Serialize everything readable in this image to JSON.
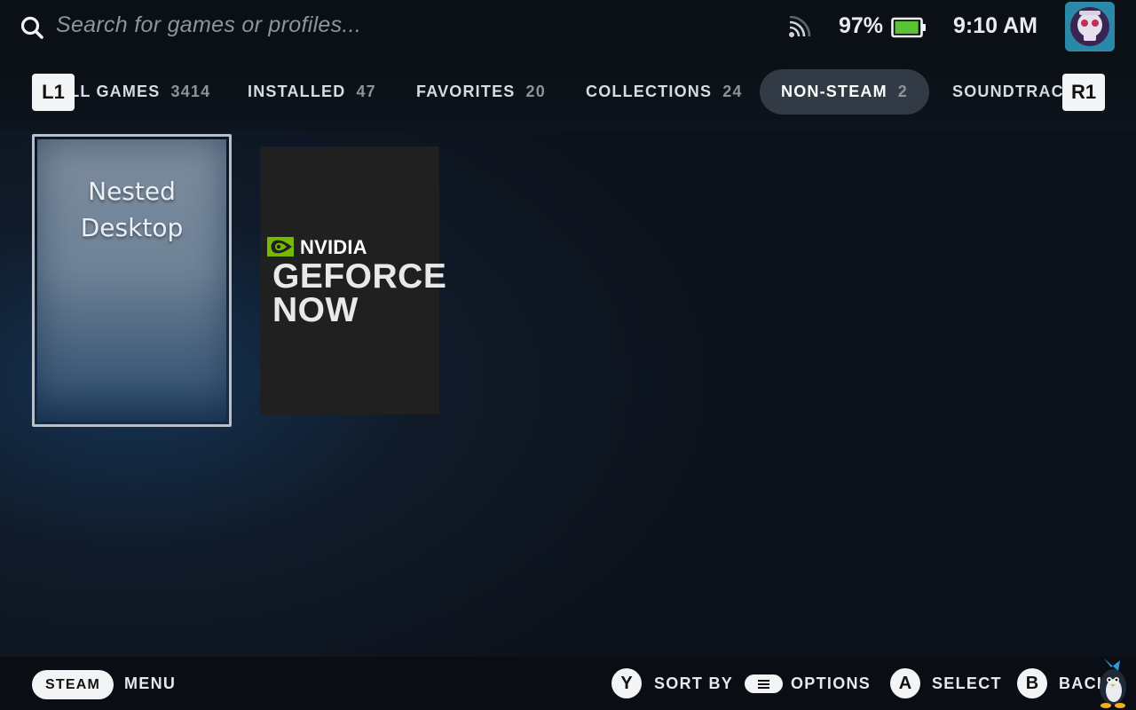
{
  "search": {
    "placeholder": "Search for games or profiles..."
  },
  "status": {
    "battery_percent": "97%",
    "battery_level": 0.97,
    "time": "9:10 AM"
  },
  "tabs": [
    {
      "label": "ALL GAMES",
      "count": "3414",
      "active": false
    },
    {
      "label": "INSTALLED",
      "count": "47",
      "active": false
    },
    {
      "label": "FAVORITES",
      "count": "20",
      "active": false
    },
    {
      "label": "COLLECTIONS",
      "count": "24",
      "active": false
    },
    {
      "label": "NON-STEAM",
      "count": "2",
      "active": true
    },
    {
      "label": "SOUNDTRACKS",
      "count": "",
      "active": false
    }
  ],
  "shoulder": {
    "left": "L1",
    "right": "R1"
  },
  "games": [
    {
      "title_line1": "Nested",
      "title_line2": "Desktop"
    },
    {
      "brand": "NVIDIA",
      "line1": "GEFORCE",
      "line2": "NOW"
    }
  ],
  "footer": {
    "steam_button": "STEAM",
    "menu_label": "MENU",
    "y_button": "Y",
    "sort_label": "SORT BY",
    "options_label": "OPTIONS",
    "a_button": "A",
    "select_label": "SELECT",
    "b_button": "B",
    "back_label": "BACK"
  },
  "colors": {
    "battery": "#5bc236",
    "nvidia_green": "#76b900",
    "active_tab_bg": "#323a45"
  },
  "icons": [
    "search-icon",
    "wifi-icon",
    "battery-icon",
    "avatar",
    "nvidia-logo-icon",
    "menu-lines-icon",
    "mascot-icon"
  ]
}
